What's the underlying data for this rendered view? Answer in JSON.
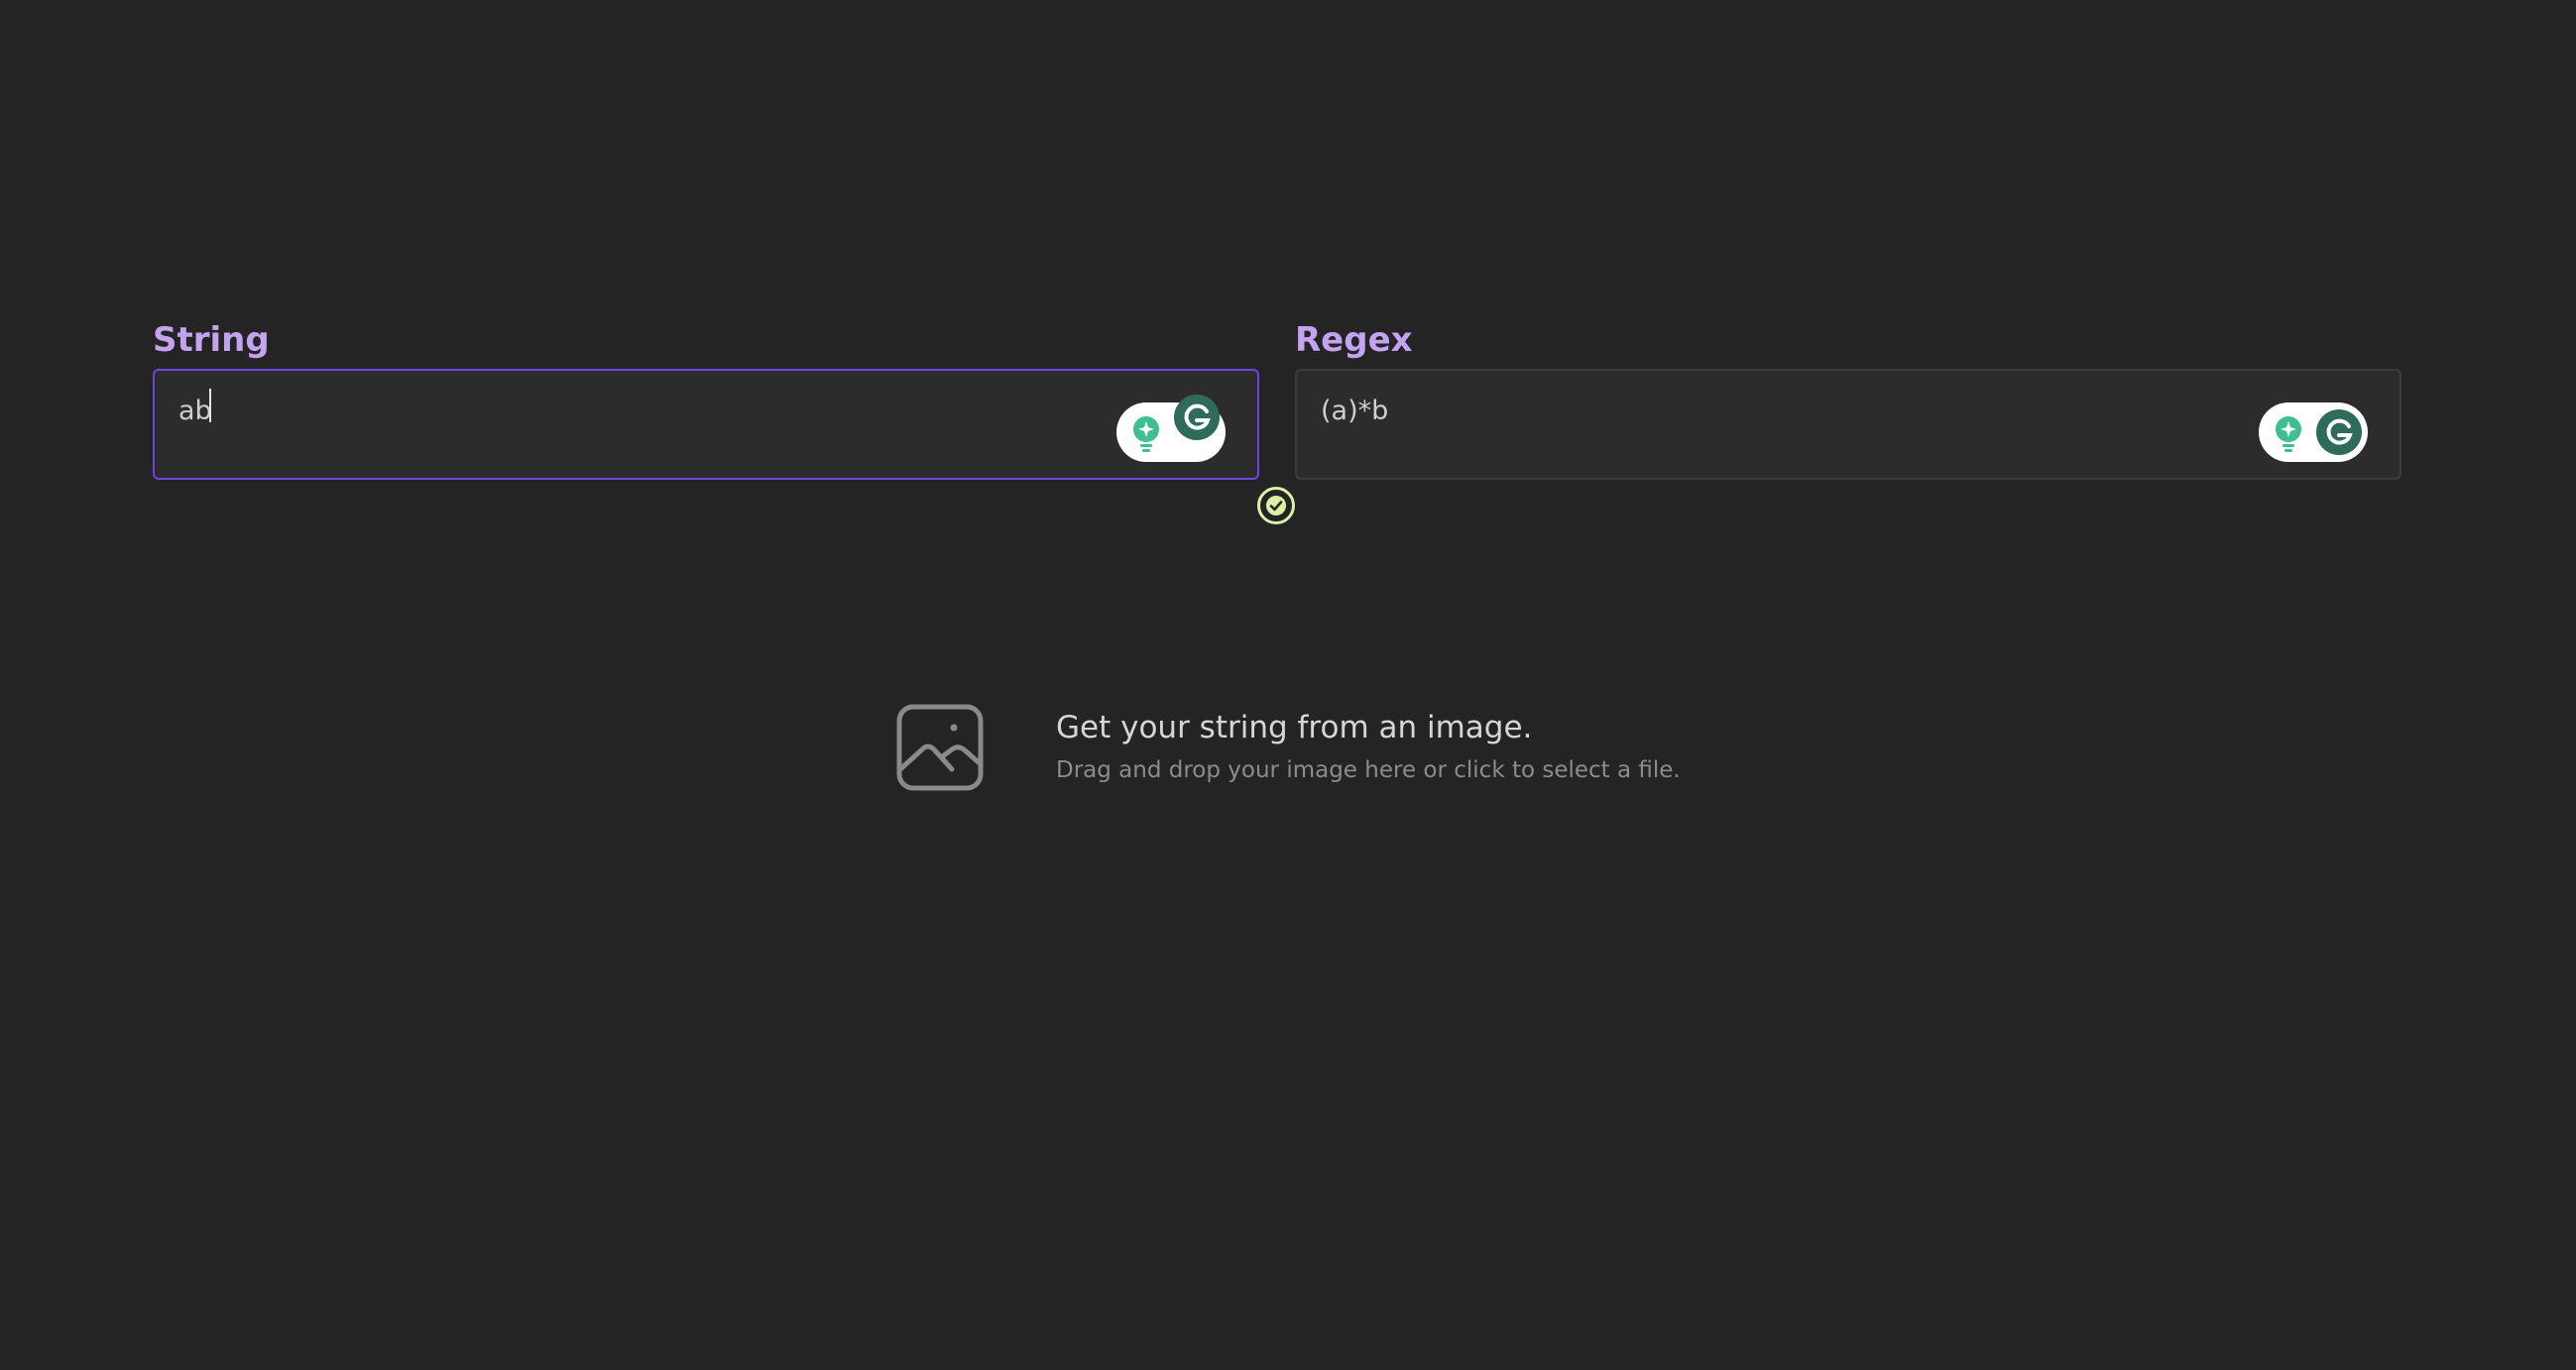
{
  "string_field": {
    "label": "String",
    "value": "ab"
  },
  "regex_field": {
    "label": "Regex",
    "value": "(a)*b"
  },
  "match_status": {
    "icon": "check-circle-icon",
    "color": "#d9f2a6"
  },
  "dropzone": {
    "icon": "image-icon",
    "title": "Get your string from an image.",
    "subtitle": "Drag and drop your image here or click to select a file."
  },
  "colors": {
    "background": "#242424",
    "label": "#c4a3f0",
    "focus_border": "#6b47d6",
    "grammarly_green": "#3dbf91",
    "grammarly_dark": "#2f6b5a"
  }
}
